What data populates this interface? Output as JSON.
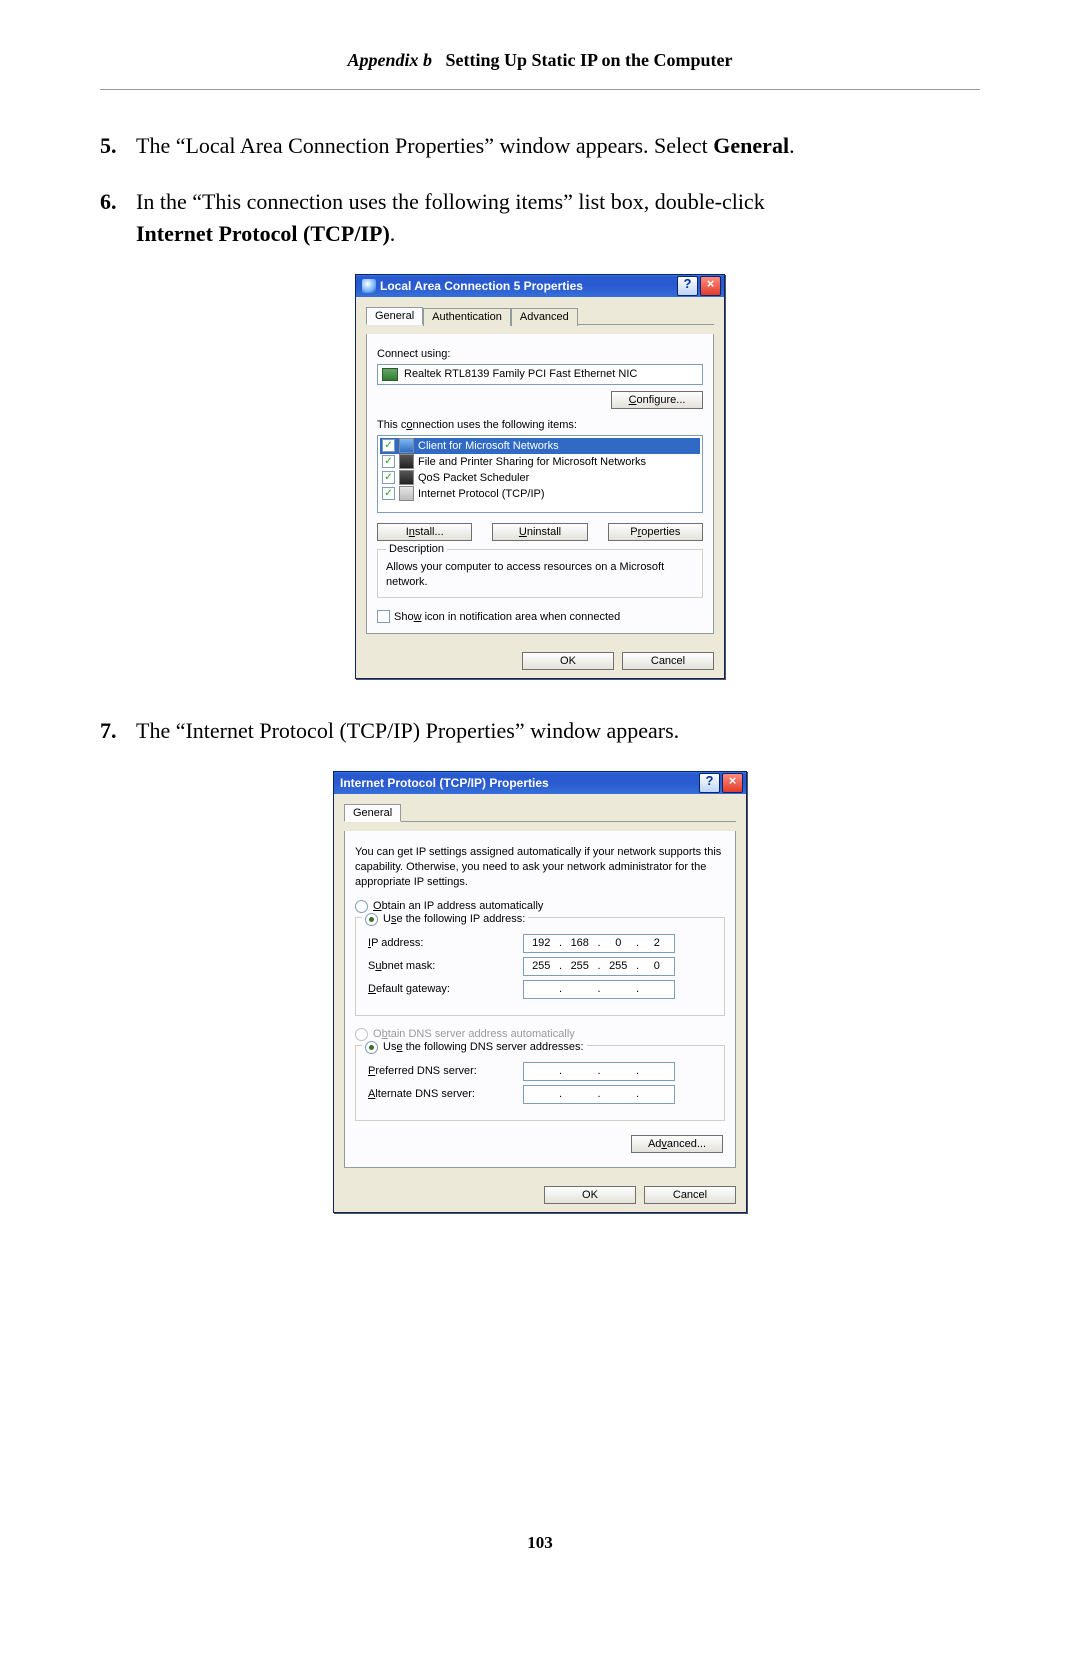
{
  "header": {
    "appendix": "Appendix b",
    "title": "Setting Up Static IP on the Computer"
  },
  "steps": {
    "s5": {
      "num": "5.",
      "text_a": "The “Local Area Connection Properties” window appears. Select ",
      "bold": "General",
      "tail": "."
    },
    "s6": {
      "num": "6.",
      "text_a": "In the “This connection uses the following items” list box, double-click ",
      "bold_a": "Internet Protocol ",
      "sc": "(TCP/IP)",
      "tail": "."
    },
    "s7": {
      "num": "7.",
      "text_a": "The “Internet Protocol ",
      "sc": "(TCP/IP)",
      "text_b": " Properties” window appears."
    }
  },
  "dlg1": {
    "title": "Local Area Connection 5 Properties",
    "tabs": {
      "general": "General",
      "auth": "Authentication",
      "adv": "Advanced"
    },
    "connect_label": "Connect using:",
    "adapter": "Realtek RTL8139 Family PCI Fast Ethernet NIC",
    "configure": "Configure...",
    "items_label": "This connection uses the following items:",
    "items": [
      "Client for Microsoft Networks",
      "File and Printer Sharing for Microsoft Networks",
      "QoS Packet Scheduler",
      "Internet Protocol (TCP/IP)"
    ],
    "install": "Install...",
    "uninstall": "Uninstall",
    "properties": "Properties",
    "desc_legend": "Description",
    "desc_text": "Allows your computer to access resources on a Microsoft network.",
    "show_icon": "Show icon in notification area when connected",
    "ok": "OK",
    "cancel": "Cancel"
  },
  "dlg2": {
    "title": "Internet Protocol (TCP/IP) Properties",
    "tab": "General",
    "intro": "You can get IP settings assigned automatically if your network supports this capability. Otherwise, you need to ask your network administrator for the appropriate IP settings.",
    "opt_auto_ip": "Obtain an IP address automatically",
    "opt_use_ip": "Use the following IP address:",
    "ip_label": "IP address:",
    "ip": [
      "192",
      "168",
      "0",
      "2"
    ],
    "mask_label": "Subnet mask:",
    "mask": [
      "255",
      "255",
      "255",
      "0"
    ],
    "gw_label": "Default gateway:",
    "opt_auto_dns": "Obtain DNS server address automatically",
    "opt_use_dns": "Use the following DNS server addresses:",
    "pref_dns_label": "Preferred DNS server:",
    "alt_dns_label": "Alternate DNS server:",
    "advanced": "Advanced...",
    "ok": "OK",
    "cancel": "Cancel"
  },
  "page_number": "103"
}
